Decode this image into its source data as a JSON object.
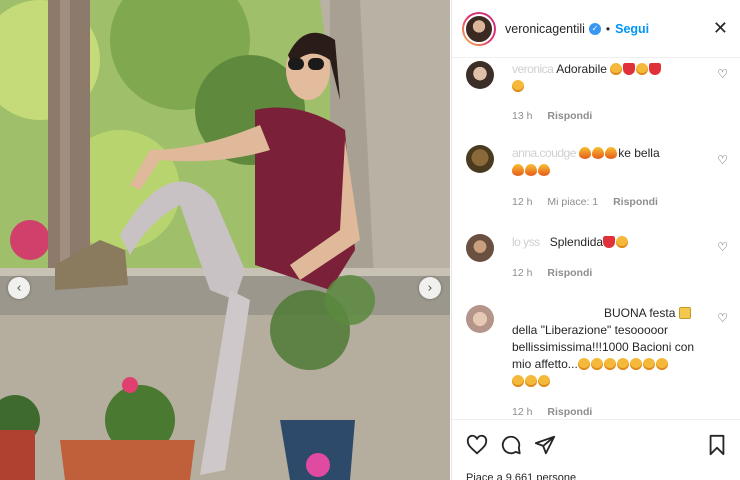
{
  "post": {
    "carousel_prev": "‹",
    "carousel_next": "›"
  },
  "header": {
    "username": "veronicagentili",
    "separator": "•",
    "follow_label": "Segui",
    "close_label": "✕"
  },
  "comments": [
    {
      "author_blur": "veronica ",
      "text": "Adorabile",
      "time": "13 h",
      "likes": "",
      "reply": "Rispondi",
      "emojis_inline": [
        "face",
        "heart",
        "face",
        "heart"
      ],
      "emojis_next_line": [
        "face"
      ]
    },
    {
      "author_blur": "anna.coudge",
      "text": "ke bella",
      "time": "12 h",
      "likes": "Mi piace: 1",
      "reply": "Rispondi",
      "emojis_before": [
        "fire",
        "fire",
        "fire"
      ],
      "emojis_next_line": [
        "fire",
        "fire",
        "fire"
      ]
    },
    {
      "author_blur": "lo  yss",
      "text": "Splendida",
      "time": "12 h",
      "likes": "",
      "reply": "Rispondi",
      "emojis_inline": [
        "heart",
        "face"
      ]
    },
    {
      "author_blur": "",
      "text_line1": "BUONA festa",
      "text_line2": "della \"Liberazione\" tesooooor",
      "text_line3": "bellissimissima!!!1000 Bacioni con",
      "text_line4": "mio affetto...",
      "time": "12 h",
      "likes": "",
      "reply": "Rispondi"
    }
  ],
  "footer": {
    "likes_text": "Piace a 9.661 persone"
  },
  "icons": [
    "heart-icon",
    "comment-icon",
    "share-icon",
    "bookmark-icon",
    "verified-icon",
    "close-icon"
  ],
  "colors": {
    "accent": "#0095f6",
    "verified": "#3897f0",
    "text": "#262626",
    "muted": "#8e8e8e"
  }
}
